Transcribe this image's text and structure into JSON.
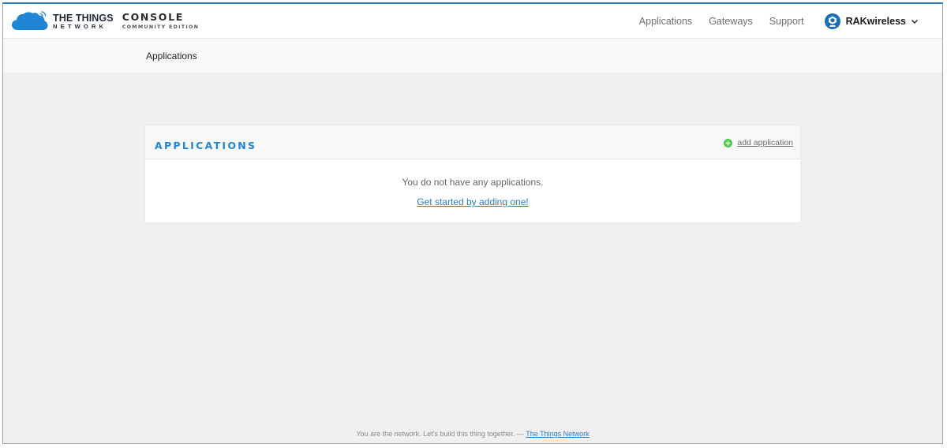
{
  "header": {
    "brand_title": "THE THINGS",
    "brand_subtitle": "NETWORK",
    "console_title": "CONSOLE",
    "console_subtitle": "COMMUNITY EDITION",
    "nav": [
      {
        "label": "Applications"
      },
      {
        "label": "Gateways"
      },
      {
        "label": "Support"
      }
    ],
    "user": {
      "name": "RAKwireless",
      "avatar_icon": "rak-logo-icon",
      "dropdown_icon": "chevron-down-icon"
    },
    "brand_icon": "cloud-signal-icon"
  },
  "breadcrumb": {
    "label": "Applications"
  },
  "card": {
    "title": "APPLICATIONS",
    "add_label": "add application",
    "add_icon": "plus-circle-icon",
    "empty_message": "You do not have any applications.",
    "cta_label": "Get started by adding one!"
  },
  "footer": {
    "text": "You are the network. Let's build this thing together. —",
    "link_label": "The Things Network"
  },
  "colors": {
    "accent": "#1f86d6",
    "link": "#2a7cc4",
    "add_icon": "#4fc94f",
    "page_bg": "#f0f0f0",
    "frame_top_border": "#2f7ab8"
  }
}
